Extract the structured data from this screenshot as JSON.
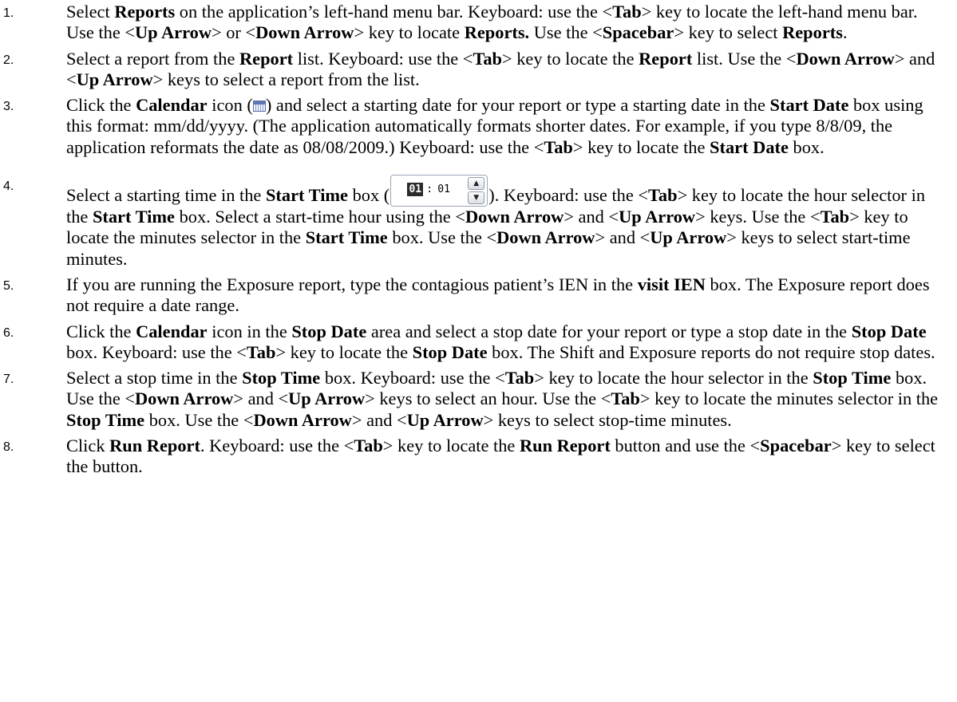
{
  "steps": [
    {
      "num": "1.",
      "parts": [
        {
          "t": "Select "
        },
        {
          "t": "Reports",
          "b": true
        },
        {
          "t": " on the application’s left-hand menu bar. Keyboard: use the <"
        },
        {
          "t": "Tab",
          "b": true
        },
        {
          "t": "> key to locate the left-hand menu bar. Use the <"
        },
        {
          "t": "Up Arrow",
          "b": true
        },
        {
          "t": "> or <"
        },
        {
          "t": "Down Arrow",
          "b": true
        },
        {
          "t": "> key to locate "
        },
        {
          "t": "Reports.",
          "b": true
        },
        {
          "t": " Use the <"
        },
        {
          "t": "Spacebar",
          "b": true
        },
        {
          "t": "> key to select "
        },
        {
          "t": "Reports",
          "b": true
        },
        {
          "t": "."
        }
      ]
    },
    {
      "num": "2.",
      "parts": [
        {
          "t": "Select a report from the "
        },
        {
          "t": "Report",
          "b": true
        },
        {
          "t": " list. Keyboard: use the <"
        },
        {
          "t": "Tab",
          "b": true
        },
        {
          "t": "> key to locate the "
        },
        {
          "t": "Report",
          "b": true
        },
        {
          "t": " list. Use the <"
        },
        {
          "t": "Down Arrow",
          "b": true
        },
        {
          "t": "> and <"
        },
        {
          "t": "Up Arrow",
          "b": true
        },
        {
          "t": "> keys to select a report from the list."
        }
      ]
    },
    {
      "num": "3.",
      "parts": [
        {
          "t": "Click the "
        },
        {
          "t": "Calendar",
          "b": true
        },
        {
          "t": " icon ("
        },
        {
          "icon": "calendar-icon"
        },
        {
          "t": ") and select a starting date for your report or type a starting date in the "
        },
        {
          "t": "Start Date",
          "b": true
        },
        {
          "t": " box using this format: mm/dd/yyyy. (The application automatically formats shorter dates. For example, if you type 8/8/09, the application reformats the date as 08/08/2009.) Keyboard: use the <"
        },
        {
          "t": "Tab",
          "b": true
        },
        {
          "t": "> key to locate the "
        },
        {
          "t": "Start Date",
          "b": true
        },
        {
          "t": " box."
        }
      ]
    },
    {
      "num": "4.",
      "tall": true,
      "parts": [
        {
          "t": "Select a starting time in the "
        },
        {
          "t": "Start Time",
          "b": true
        },
        {
          "t": " box ("
        },
        {
          "spinner": true
        },
        {
          "t": "). Keyboard: use the <"
        },
        {
          "t": "Tab",
          "b": true
        },
        {
          "t": "> key to locate the hour selector in the "
        },
        {
          "t": "Start Time",
          "b": true
        },
        {
          "t": " box. Select a start-time hour using the <"
        },
        {
          "t": "Down Arrow",
          "b": true
        },
        {
          "t": "> and <"
        },
        {
          "t": "Up Arrow",
          "b": true
        },
        {
          "t": "> keys. Use the <"
        },
        {
          "t": "Tab",
          "b": true
        },
        {
          "t": "> key to locate the minutes selector in the "
        },
        {
          "t": "Start Time",
          "b": true
        },
        {
          "t": " box. Use the <"
        },
        {
          "t": "Down Arrow",
          "b": true
        },
        {
          "t": "> and <"
        },
        {
          "t": "Up Arrow",
          "b": true
        },
        {
          "t": "> keys to select start-time minutes."
        }
      ]
    },
    {
      "num": "5.",
      "parts": [
        {
          "t": "If you are running the Exposure report, type the contagious patient’s IEN in the "
        },
        {
          "t": "visit IEN",
          "b": true
        },
        {
          "t": " box. The Exposure report does not require a date range."
        }
      ]
    },
    {
      "num": "6.",
      "parts": [
        {
          "t": "Click the "
        },
        {
          "t": "Calendar",
          "b": true
        },
        {
          "t": " icon in the "
        },
        {
          "t": "Stop Date",
          "b": true
        },
        {
          "t": " area and select a stop date for your report or type a stop date in the "
        },
        {
          "t": "Stop Date",
          "b": true
        },
        {
          "t": " box. Keyboard: use the <"
        },
        {
          "t": "Tab",
          "b": true
        },
        {
          "t": "> key to locate the "
        },
        {
          "t": "Stop Date",
          "b": true
        },
        {
          "t": " box. The Shift and Exposure reports do not require stop dates."
        }
      ]
    },
    {
      "num": "7.",
      "parts": [
        {
          "t": "Select a stop time in the "
        },
        {
          "t": "Stop Time",
          "b": true
        },
        {
          "t": " box. Keyboard: use the <"
        },
        {
          "t": "Tab",
          "b": true
        },
        {
          "t": "> key to locate the hour selector in the "
        },
        {
          "t": "Stop Time",
          "b": true
        },
        {
          "t": " box. Use the <"
        },
        {
          "t": "Down Arrow",
          "b": true
        },
        {
          "t": "> and <"
        },
        {
          "t": "Up Arrow",
          "b": true
        },
        {
          "t": "> keys to select an hour. Use the <"
        },
        {
          "t": "Tab",
          "b": true
        },
        {
          "t": "> key to locate the minutes selector in the "
        },
        {
          "t": "Stop Time",
          "b": true
        },
        {
          "t": " box. Use the <"
        },
        {
          "t": "Down Arrow",
          "b": true
        },
        {
          "t": "> and <"
        },
        {
          "t": "Up Arrow",
          "b": true
        },
        {
          "t": "> keys to select stop-time minutes."
        }
      ]
    },
    {
      "num": "8.",
      "parts": [
        {
          "t": "Click "
        },
        {
          "t": "Run Report",
          "b": true
        },
        {
          "t": ". Keyboard: use the <"
        },
        {
          "t": "Tab",
          "b": true
        },
        {
          "t": "> key to locate the "
        },
        {
          "t": "Run Report",
          "b": true
        },
        {
          "t": " button and use the <"
        },
        {
          "t": "Spacebar",
          "b": true
        },
        {
          "t": "> key to select the button."
        }
      ]
    }
  ],
  "start_time_widget": {
    "hour": "01",
    "separator": ":",
    "minute": "01",
    "up_icon": "spin-up-icon",
    "down_icon": "spin-down-icon"
  }
}
